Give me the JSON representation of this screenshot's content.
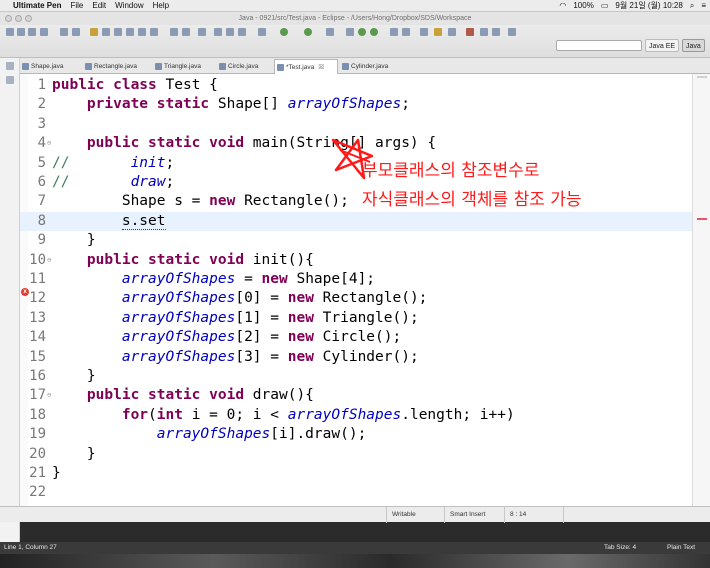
{
  "menubar": {
    "app_name": "Ultimate Pen",
    "items": [
      "File",
      "Edit",
      "Window",
      "Help"
    ],
    "battery": "100%",
    "datetime": "9월 21일 (월)  10:28"
  },
  "window": {
    "title": "Java - 0921/src/Test.java - Eclipse - /Users/Hong/Dropbox/SDS/Workspace"
  },
  "perspectives": [
    "Java EE",
    "Java"
  ],
  "tabs": [
    {
      "label": "Shape.java"
    },
    {
      "label": "Rectangle.java"
    },
    {
      "label": "Triangle.java"
    },
    {
      "label": "Circle.java"
    },
    {
      "label": "*Test.java",
      "close": "☒"
    },
    {
      "label": "Cylinder.java"
    }
  ],
  "code_lines": [
    {
      "n": "1",
      "tokens": [
        [
          "kw",
          "public "
        ],
        [
          "kw",
          "class "
        ],
        [
          "",
          "Test {"
        ]
      ]
    },
    {
      "n": "2",
      "tokens": [
        [
          "",
          "    "
        ],
        [
          "kw",
          "private "
        ],
        [
          "kw",
          "static "
        ],
        [
          "",
          "Shape[] "
        ],
        [
          "fld",
          "arrayOfShapes"
        ],
        [
          "",
          ";"
        ]
      ]
    },
    {
      "n": "3",
      "tokens": []
    },
    {
      "n": "4",
      "fold": true,
      "tokens": [
        [
          "",
          "    "
        ],
        [
          "kw",
          "public "
        ],
        [
          "kw",
          "static "
        ],
        [
          "kw",
          "void "
        ],
        [
          "",
          "main(String[] args) {"
        ]
      ]
    },
    {
      "n": "5",
      "tokens": [
        [
          "cm",
          "//       "
        ],
        [
          "fld",
          "init"
        ],
        [
          "",
          ";"
        ]
      ]
    },
    {
      "n": "6",
      "tokens": [
        [
          "cm",
          "//       "
        ],
        [
          "fld",
          "draw"
        ],
        [
          "",
          ";"
        ]
      ]
    },
    {
      "n": "7",
      "tokens": [
        [
          "",
          "        Shape s = "
        ],
        [
          "kw",
          "new "
        ],
        [
          "",
          "Rectangle();"
        ]
      ]
    },
    {
      "n": "8",
      "current": true,
      "tokens": [
        [
          "",
          "        "
        ],
        [
          "err",
          "s.set"
        ]
      ]
    },
    {
      "n": "9",
      "tokens": [
        [
          "",
          "    }"
        ]
      ]
    },
    {
      "n": "10",
      "fold": true,
      "tokens": [
        [
          "",
          "    "
        ],
        [
          "kw",
          "public "
        ],
        [
          "kw",
          "static "
        ],
        [
          "kw",
          "void "
        ],
        [
          "",
          "init(){"
        ]
      ]
    },
    {
      "n": "11",
      "tokens": [
        [
          "",
          "        "
        ],
        [
          "fld",
          "arrayOfShapes"
        ],
        [
          "",
          " = "
        ],
        [
          "kw",
          "new "
        ],
        [
          "",
          "Shape[4];"
        ]
      ]
    },
    {
      "n": "12",
      "tokens": [
        [
          "",
          "        "
        ],
        [
          "fld",
          "arrayOfShapes"
        ],
        [
          "",
          "[0] = "
        ],
        [
          "kw",
          "new "
        ],
        [
          "",
          "Rectangle();"
        ]
      ]
    },
    {
      "n": "13",
      "tokens": [
        [
          "",
          "        "
        ],
        [
          "fld",
          "arrayOfShapes"
        ],
        [
          "",
          "[1] = "
        ],
        [
          "kw",
          "new "
        ],
        [
          "",
          "Triangle();"
        ]
      ]
    },
    {
      "n": "14",
      "tokens": [
        [
          "",
          "        "
        ],
        [
          "fld",
          "arrayOfShapes"
        ],
        [
          "",
          "[2] = "
        ],
        [
          "kw",
          "new "
        ],
        [
          "",
          "Circle();"
        ]
      ]
    },
    {
      "n": "15",
      "tokens": [
        [
          "",
          "        "
        ],
        [
          "fld",
          "arrayOfShapes"
        ],
        [
          "",
          "[3] = "
        ],
        [
          "kw",
          "new "
        ],
        [
          "",
          "Cylinder();"
        ]
      ]
    },
    {
      "n": "16",
      "tokens": [
        [
          "",
          "    }"
        ]
      ]
    },
    {
      "n": "17",
      "fold": true,
      "tokens": [
        [
          "",
          "    "
        ],
        [
          "kw",
          "public "
        ],
        [
          "kw",
          "static "
        ],
        [
          "kw",
          "void "
        ],
        [
          "",
          "draw(){"
        ]
      ]
    },
    {
      "n": "18",
      "tokens": [
        [
          "",
          "        "
        ],
        [
          "kw",
          "for"
        ],
        [
          "",
          "("
        ],
        [
          "kw",
          "int "
        ],
        [
          "",
          "i = 0; i < "
        ],
        [
          "fld",
          "arrayOfShapes"
        ],
        [
          "",
          ".length; i++)"
        ]
      ]
    },
    {
      "n": "19",
      "tokens": [
        [
          "",
          "            "
        ],
        [
          "fld",
          "arrayOfShapes"
        ],
        [
          "",
          "[i].draw();"
        ]
      ]
    },
    {
      "n": "20",
      "tokens": [
        [
          "",
          "    }"
        ]
      ]
    },
    {
      "n": "21",
      "tokens": [
        [
          "",
          "}"
        ]
      ]
    },
    {
      "n": "22",
      "tokens": []
    }
  ],
  "annotation": {
    "line1": "부모클래스의 참조변수로",
    "line2": "자식클래스의 객체를 참조 가능",
    "color": "#ff1a1a"
  },
  "statusbar": {
    "mode": "Writable",
    "insert": "Smart Insert",
    "position": "8 : 14"
  },
  "bottombar": {
    "left": "Line 1, Column 27",
    "tab_size": "Tab Size: 4",
    "text_mode": "Plain Text"
  },
  "colors": {
    "keyword": "#7f0055",
    "field": "#0000c0",
    "comment": "#3f7f5f",
    "current_line": "#e8f2fe"
  }
}
